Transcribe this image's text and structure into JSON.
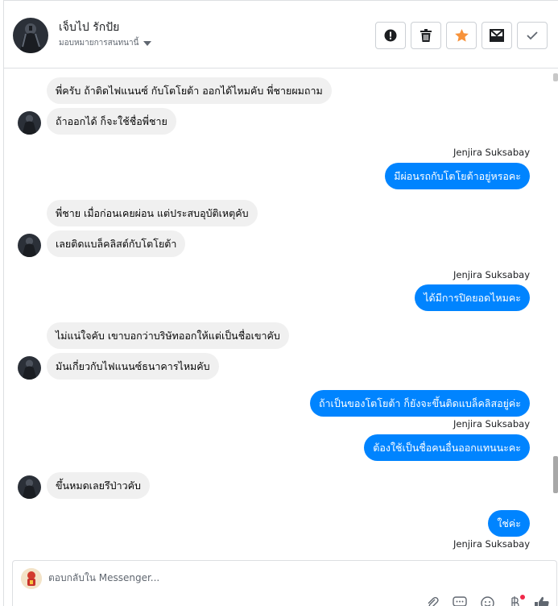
{
  "header": {
    "contact_name": "เจ็บไป รักปัย",
    "assign_label": "มอบหมายการสนทนานี้",
    "actions": [
      {
        "icon": "alert-icon",
        "name": "mark-spam-button"
      },
      {
        "icon": "trash-icon",
        "name": "delete-button"
      },
      {
        "icon": "star-icon",
        "name": "star-button"
      },
      {
        "icon": "mark-unread-icon",
        "name": "mark-unread-button"
      },
      {
        "icon": "checkmark-icon",
        "name": "mark-done-button"
      }
    ]
  },
  "messages": [
    {
      "from": "contact",
      "text": "พี่ครับ ถ้าติดไฟแนนซ์ กับโตโยต้า ออกได้ไหมคับ พี่ชายผมถาม"
    },
    {
      "from": "contact",
      "text": "ถ้าออกได้ ก็จะใช้ชื่อพี่ชาย"
    },
    {
      "from": "page",
      "sender": "Jenjira Suksabay",
      "text": "มีผ่อนรถกับโตโยต้าอยู่หรอคะ"
    },
    {
      "from": "contact",
      "text": "พี่ชาย เมื่อก่อนเคยผ่อน แต่ประสบอุบัติเหตุคับ"
    },
    {
      "from": "contact",
      "text": "เลยติดแบล็คลิสต์กับโตโยต้า"
    },
    {
      "from": "page",
      "sender": "Jenjira Suksabay",
      "text": "ได้มีการปิดยอดไหมคะ"
    },
    {
      "from": "contact",
      "text": "ไม่แน่ใจคับ เขาบอกว่าบริษัทออกให้แต่เป็นชื่อเขาคับ"
    },
    {
      "from": "contact",
      "text": "มันเกี่ยวกับไฟแนนซ์ธนาคารไหมคับ"
    },
    {
      "from": "page",
      "text": "ถ้าเป็นของโตโยต้า ก็ยังจะขึ้นติดแบล็คลิสอยู่ค่ะ"
    },
    {
      "from": "page",
      "sender": "Jenjira Suksabay",
      "text": "ต้องใช้เป็นชื่อคนอื่นออกแทนนะคะ"
    },
    {
      "from": "contact",
      "text": "ขึ้นหมดเลยรึป่าวคับ"
    },
    {
      "from": "page",
      "sender": "Jenjira Suksabay",
      "text": "ใช่ค่ะ"
    }
  ],
  "composer": {
    "placeholder": "ตอบกลับใน Messenger...",
    "tools": [
      "attachment-icon",
      "saved-replies-icon",
      "emoji-icon",
      "payment-icon",
      "thumbs-up-icon"
    ]
  },
  "colors": {
    "outgoing_bubble": "#0084ff",
    "incoming_bubble": "#f0f0f0",
    "star_accent": "#f7923a"
  }
}
